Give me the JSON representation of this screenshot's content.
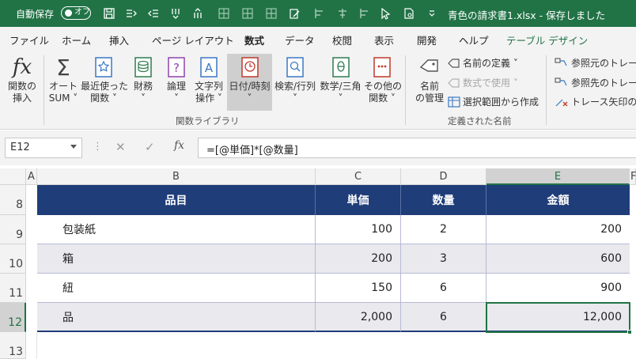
{
  "titlebar": {
    "autosave_label": "自動保存",
    "autosave_state": "オフ",
    "document_title": "青色の請求書1.xlsx  -  保存しました"
  },
  "menu": {
    "tabs": [
      "ファイル",
      "ホーム",
      "挿入",
      "ページ レイアウト",
      "数式",
      "データ",
      "校閲",
      "表示",
      "開発",
      "ヘルプ",
      "テーブル デザイン"
    ],
    "active": "数式"
  },
  "ribbon": {
    "buttons": [
      {
        "line1": "関数の",
        "line2": "挿入"
      },
      {
        "line1": "オート",
        "line2": "SUM ˅"
      },
      {
        "line1": "最近使った",
        "line2": "関数 ˅"
      },
      {
        "line1": "財務",
        "line2": "˅"
      },
      {
        "line1": "論理",
        "line2": "˅"
      },
      {
        "line1": "文字列",
        "line2": "操作 ˅"
      },
      {
        "line1": "日付/時刻",
        "line2": "˅"
      },
      {
        "line1": "検索/行列",
        "line2": "˅"
      },
      {
        "line1": "数学/三角",
        "line2": "˅"
      },
      {
        "line1": "その他の",
        "line2": "関数 ˅"
      }
    ],
    "group_function_library": "関数ライブラリ",
    "name_manager_line1": "名前",
    "name_manager_line2": "の管理",
    "define_name": "名前の定義  ˅",
    "use_in_formula": "数式で使用 ˅",
    "create_from_selection": "選択範囲から作成",
    "group_defined_names": "定義された名前",
    "trace_precedents": "参照元のトレース",
    "trace_dependents": "参照先のトレース",
    "remove_arrows": "トレース矢印の削除"
  },
  "formula_bar": {
    "name_box": "E12",
    "cancel": "✕",
    "enter": "✓",
    "fx": "fx",
    "formula": "=[@単価]*[@数量]"
  },
  "grid": {
    "columns": [
      "A",
      "B",
      "C",
      "D",
      "E",
      "F"
    ],
    "rows": [
      "8",
      "9",
      "10",
      "11",
      "12",
      "13"
    ],
    "selected_cell": "E12",
    "table_header": [
      "品目",
      "単価",
      "数量",
      "金額"
    ],
    "table_rows": [
      [
        "包装紙",
        "100",
        "2",
        "200"
      ],
      [
        "箱",
        "200",
        "3",
        "600"
      ],
      [
        "紐",
        "150",
        "6",
        "900"
      ],
      [
        "品",
        "2,000",
        "6",
        "12,000"
      ]
    ],
    "colors": {
      "header_fill": "#1f3d78",
      "band_fill": "#e9e9ee",
      "accent": "#217346"
    }
  }
}
